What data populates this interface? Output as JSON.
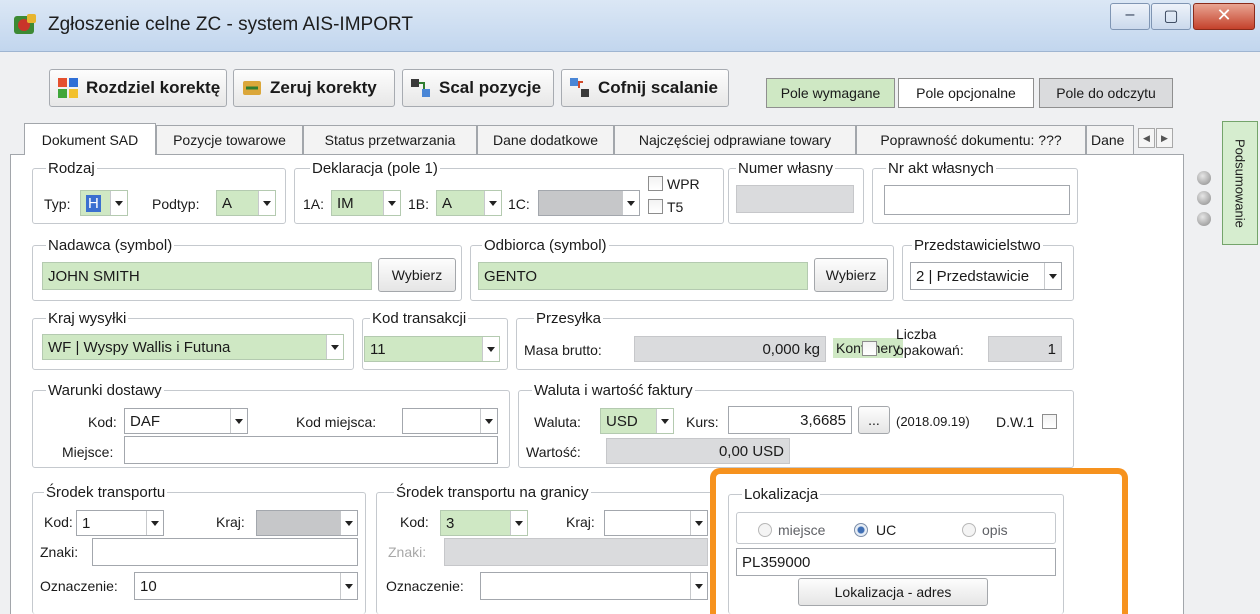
{
  "window": {
    "title": "Zgłoszenie celne ZC - system AIS-IMPORT",
    "minimize_glyph": "–",
    "maximize_glyph": "▢",
    "close_glyph": "✕"
  },
  "toolbar": {
    "split_correction": "Rozdziel korektę",
    "reset_corrections": "Zeruj korekty",
    "merge_items": "Scal pozycje",
    "undo_merge": "Cofnij scalanie"
  },
  "legend": {
    "required": "Pole wymagane",
    "optional": "Pole opcjonalne",
    "readonly": "Pole do odczytu",
    "required_color": "#cfe8c4",
    "readonly_color": "#dadbdd"
  },
  "tabs": [
    "Dokument SAD",
    "Pozycje towarowe",
    "Status przetwarzania",
    "Dane dodatkowe",
    "Najczęściej odprawiane towary",
    "Poprawność dokumentu: ???",
    "Dane"
  ],
  "side_tab": "Podsumowanie",
  "rodzaj": {
    "title": "Rodzaj",
    "typ_label": "Typ:",
    "typ_value": "H",
    "podtyp_label": "Podtyp:",
    "podtyp_value": "A"
  },
  "deklaracja": {
    "title": "Deklaracja (pole 1)",
    "l1a": "1A:",
    "v1a": "IM",
    "l1b": "1B:",
    "v1b": "A",
    "l1c": "1C:",
    "v1c": "",
    "wpr": "WPR",
    "t5": "T5"
  },
  "numer_wlasny": {
    "title": "Numer własny",
    "value": ""
  },
  "nr_akt": {
    "title": "Nr akt własnych",
    "value": ""
  },
  "nadawca": {
    "title": "Nadawca (symbol)",
    "value": "JOHN SMITH",
    "button": "Wybierz"
  },
  "odbiorca": {
    "title": "Odbiorca (symbol)",
    "value": "GENTO",
    "button": "Wybierz"
  },
  "przedstawicielstwo": {
    "title": "Przedstawicielstwo",
    "value": "2 | Przedstawicie"
  },
  "kraj_wysylki": {
    "title": "Kraj wysyłki",
    "value": "WF | Wyspy Wallis i Futuna"
  },
  "kod_transakcji": {
    "title": "Kod transakcji",
    "value": "11"
  },
  "przesylka": {
    "title": "Przesyłka",
    "masa_label": "Masa brutto:",
    "masa_value": "0,000 kg",
    "kontenery_label": "Kontenery",
    "liczba_label_1": "Liczba",
    "liczba_label_2": "opakowań:",
    "liczba_value": "1"
  },
  "warunki": {
    "title": "Warunki dostawy",
    "kod_label": "Kod:",
    "kod_value": "DAF",
    "kod_miejsca_label": "Kod miejsca:",
    "kod_miejsca_value": "",
    "miejsce_label": "Miejsce:",
    "miejsce_value": ""
  },
  "waluta": {
    "title": "Waluta i wartość faktury",
    "waluta_label": "Waluta:",
    "waluta_value": "USD",
    "kurs_label": "Kurs:",
    "kurs_value": "3,6685",
    "ellipsis": "...",
    "date_text": "(2018.09.19)",
    "dw_label": "D.W.1",
    "wartosc_label": "Wartość:",
    "wartosc_value": "0,00 USD"
  },
  "srodek_transportu": {
    "title": "Środek transportu",
    "kod_label": "Kod:",
    "kod_value": "1",
    "kraj_label": "Kraj:",
    "kraj_value": "",
    "znaki_label": "Znaki:",
    "znaki_value": "",
    "oznaczenie_label": "Oznaczenie:",
    "oznaczenie_value": "10"
  },
  "srodek_granicy": {
    "title": "Środek transportu na granicy",
    "kod_label": "Kod:",
    "kod_value": "3",
    "kraj_label": "Kraj:",
    "kraj_value": "",
    "znaki_label": "Znaki:",
    "znaki_value": "",
    "oznaczenie_label": "Oznaczenie:",
    "oznaczenie_value": ""
  },
  "lokalizacja": {
    "title": "Lokalizacja",
    "radio_miejsce": "miejsce",
    "radio_uc": "UC",
    "radio_opis": "opis",
    "selected": "UC",
    "value": "PL359000",
    "button": "Lokalizacja - adres",
    "highlight_color": "#f6921e"
  }
}
